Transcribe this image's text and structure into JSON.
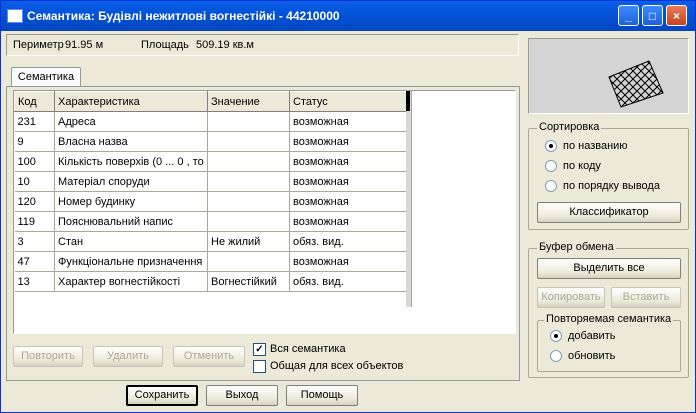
{
  "window": {
    "title": "Семантика: Будівлі нежитлові вогнестійкі - 44210000",
    "minimize": "_",
    "maximize": "□",
    "close": "×"
  },
  "info": {
    "perimeter_label": "Периметр",
    "perimeter_value": "91.95 м",
    "area_label": "Площадь",
    "area_value": "509.19 кв.м"
  },
  "tab": {
    "label": "Семантика"
  },
  "table": {
    "columns": [
      "Код",
      "Характеристика",
      "Значение",
      "Статус"
    ],
    "rows": [
      [
        "231",
        "Адреса",
        "",
        "возможная"
      ],
      [
        "9",
        "Власна назва",
        "",
        "возможная"
      ],
      [
        "100",
        "Кількість поверхів  (0 ... 0 , то",
        "",
        "возможная"
      ],
      [
        "10",
        "Матеріал споруди",
        "",
        "возможная"
      ],
      [
        "120",
        "Номер будинку",
        "",
        "возможная"
      ],
      [
        "119",
        "Пояснювальний напис",
        "",
        "возможная"
      ],
      [
        "3",
        "Стан",
        "Не жилий",
        "обяз. вид."
      ],
      [
        "47",
        "Функціональне призначення",
        "",
        "возможная"
      ],
      [
        "13",
        "Характер вогнестійкості",
        "Вогнестійкий",
        "обяз. вид."
      ]
    ]
  },
  "actions": {
    "repeat": "Повторить",
    "delete": "Удалить",
    "cancel": "Отменить"
  },
  "checks": {
    "all_semantics": "Вся семантика",
    "all_semantics_checked": true,
    "common_for_all": "Общая для всех объектов",
    "common_for_all_checked": false
  },
  "sort": {
    "title": "Сортировка",
    "by_name": "по названию",
    "by_code": "по коду",
    "by_order": "по порядку вывода",
    "selected": "by_name",
    "classifier": "Классификатор"
  },
  "buffer": {
    "title": "Буфер обмена",
    "select_all": "Выделить все",
    "copy": "Копировать",
    "paste": "Вставить",
    "repeat_title": "Повторяемая семантика",
    "add": "добавить",
    "update": "обновить",
    "selected": "add"
  },
  "bottom": {
    "save": "Сохранить",
    "exit": "Выход",
    "help": "Помощь"
  }
}
